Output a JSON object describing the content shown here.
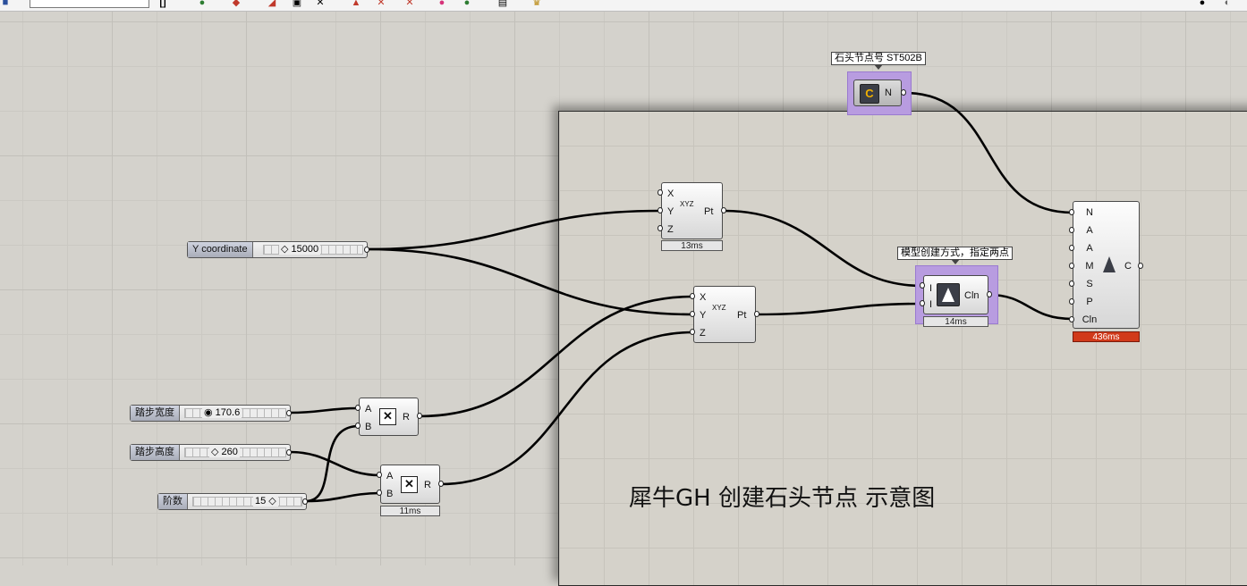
{
  "toolbar": {
    "icons": [
      "frame-icon",
      "eye-icon",
      "paint-icon",
      "sketch-icon",
      "preview-icon",
      "x-icon",
      "x-icon",
      "x-icon",
      "bake-icon",
      "display-icon",
      "list-icon",
      "trophy-icon"
    ]
  },
  "canvas": {
    "note_text": "犀牛GH 创建石头节点 示意图"
  },
  "panel_tag": {
    "text": "石头节点号 ST502B"
  },
  "code_param": {
    "icon_letter": "C",
    "output": "N"
  },
  "pt1": {
    "inputs": [
      "X",
      "Y",
      "Z"
    ],
    "output": "Pt",
    "icon_text": "XYZ",
    "timer": "13ms"
  },
  "pt2": {
    "inputs": [
      "X",
      "Y",
      "Z"
    ],
    "output": "Pt",
    "icon_text": "XYZ"
  },
  "model_tag": {
    "text": "模型创建方式，指定两点"
  },
  "model_comp": {
    "inputs": [
      "I",
      "I"
    ],
    "output": "Cln",
    "timer": "14ms"
  },
  "big_comp": {
    "inputs": [
      "N",
      "A",
      "A",
      "M",
      "S",
      "P",
      "Cln"
    ],
    "output": "C",
    "timer": "436ms"
  },
  "mult1": {
    "inputs": [
      "A",
      "B"
    ],
    "output": "R"
  },
  "mult2": {
    "inputs": [
      "A",
      "B"
    ],
    "output": "R",
    "timer": "11ms"
  },
  "sliders": {
    "y_coord": {
      "label": "Y coordinate",
      "value": "15000"
    },
    "step_width": {
      "label": "踏步宽度",
      "value": "170.6"
    },
    "step_height": {
      "label": "踏步高度",
      "value": "260"
    },
    "steps": {
      "label": "阶数",
      "value": "15"
    }
  },
  "colors": {
    "selection": "#b89ce0",
    "error_timer": "#d13a1a"
  }
}
